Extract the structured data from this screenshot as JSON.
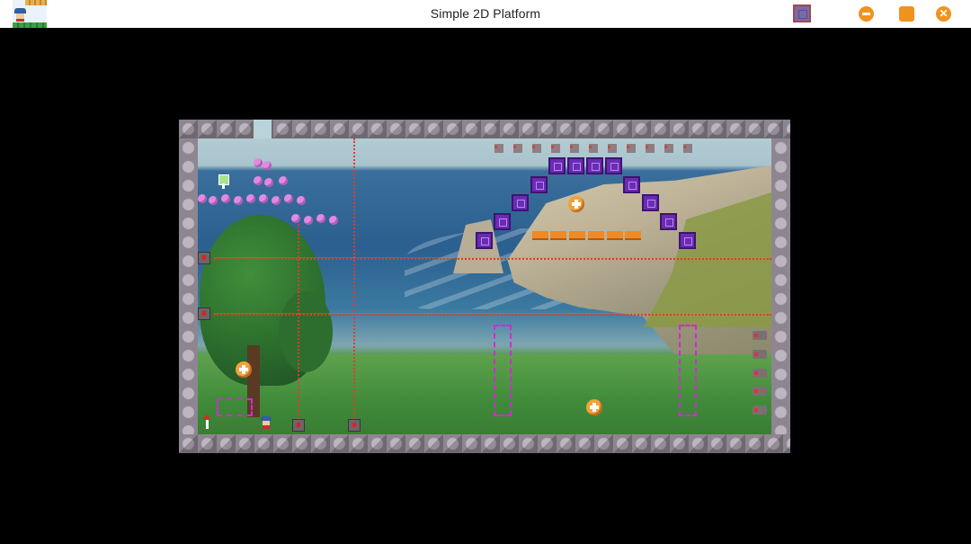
{
  "window": {
    "title": "Simple 2D Platform",
    "controls": [
      {
        "name": "layout-toggle",
        "icon": "square-icon"
      },
      {
        "name": "minimize",
        "icon": "minus-circle-icon"
      },
      {
        "name": "maximize",
        "icon": "square-rounded-icon"
      },
      {
        "name": "close",
        "icon": "x-circle-icon",
        "glyph": "✕"
      }
    ],
    "accent": "#f0921e"
  },
  "game": {
    "level_description_hidden": true,
    "colors": {
      "border": "#8d8690",
      "platform_purple": "#6b2bb3",
      "platform_orange": "#f08a24",
      "laser": "#e23b2e",
      "dash_zone": "#d12ad6",
      "coin": "#f2a23a"
    }
  }
}
